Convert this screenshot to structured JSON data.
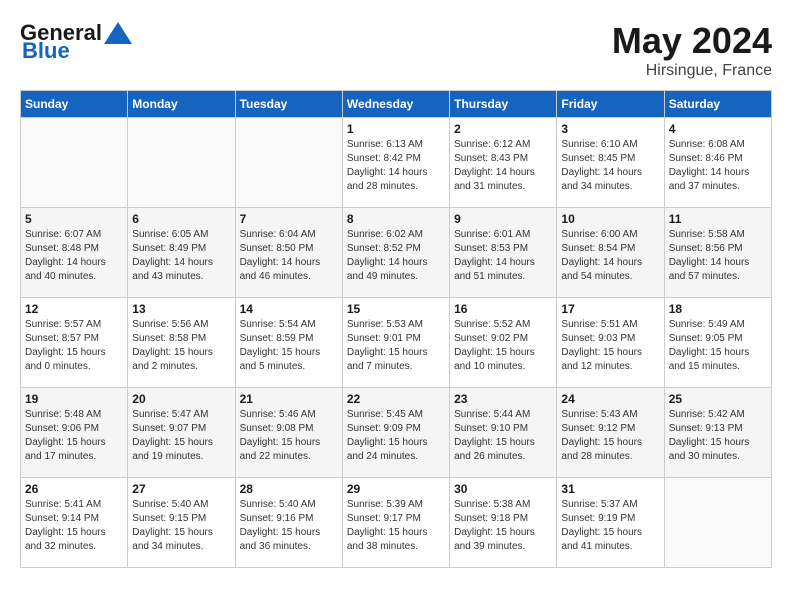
{
  "header": {
    "logo_general": "General",
    "logo_blue": "Blue",
    "month_year": "May 2024",
    "location": "Hirsingue, France"
  },
  "weekdays": [
    "Sunday",
    "Monday",
    "Tuesday",
    "Wednesday",
    "Thursday",
    "Friday",
    "Saturday"
  ],
  "weeks": [
    [
      {
        "day": "",
        "sunrise": "",
        "sunset": "",
        "daylight": ""
      },
      {
        "day": "",
        "sunrise": "",
        "sunset": "",
        "daylight": ""
      },
      {
        "day": "",
        "sunrise": "",
        "sunset": "",
        "daylight": ""
      },
      {
        "day": "1",
        "sunrise": "Sunrise: 6:13 AM",
        "sunset": "Sunset: 8:42 PM",
        "daylight": "Daylight: 14 hours and 28 minutes."
      },
      {
        "day": "2",
        "sunrise": "Sunrise: 6:12 AM",
        "sunset": "Sunset: 8:43 PM",
        "daylight": "Daylight: 14 hours and 31 minutes."
      },
      {
        "day": "3",
        "sunrise": "Sunrise: 6:10 AM",
        "sunset": "Sunset: 8:45 PM",
        "daylight": "Daylight: 14 hours and 34 minutes."
      },
      {
        "day": "4",
        "sunrise": "Sunrise: 6:08 AM",
        "sunset": "Sunset: 8:46 PM",
        "daylight": "Daylight: 14 hours and 37 minutes."
      }
    ],
    [
      {
        "day": "5",
        "sunrise": "Sunrise: 6:07 AM",
        "sunset": "Sunset: 8:48 PM",
        "daylight": "Daylight: 14 hours and 40 minutes."
      },
      {
        "day": "6",
        "sunrise": "Sunrise: 6:05 AM",
        "sunset": "Sunset: 8:49 PM",
        "daylight": "Daylight: 14 hours and 43 minutes."
      },
      {
        "day": "7",
        "sunrise": "Sunrise: 6:04 AM",
        "sunset": "Sunset: 8:50 PM",
        "daylight": "Daylight: 14 hours and 46 minutes."
      },
      {
        "day": "8",
        "sunrise": "Sunrise: 6:02 AM",
        "sunset": "Sunset: 8:52 PM",
        "daylight": "Daylight: 14 hours and 49 minutes."
      },
      {
        "day": "9",
        "sunrise": "Sunrise: 6:01 AM",
        "sunset": "Sunset: 8:53 PM",
        "daylight": "Daylight: 14 hours and 51 minutes."
      },
      {
        "day": "10",
        "sunrise": "Sunrise: 6:00 AM",
        "sunset": "Sunset: 8:54 PM",
        "daylight": "Daylight: 14 hours and 54 minutes."
      },
      {
        "day": "11",
        "sunrise": "Sunrise: 5:58 AM",
        "sunset": "Sunset: 8:56 PM",
        "daylight": "Daylight: 14 hours and 57 minutes."
      }
    ],
    [
      {
        "day": "12",
        "sunrise": "Sunrise: 5:57 AM",
        "sunset": "Sunset: 8:57 PM",
        "daylight": "Daylight: 15 hours and 0 minutes."
      },
      {
        "day": "13",
        "sunrise": "Sunrise: 5:56 AM",
        "sunset": "Sunset: 8:58 PM",
        "daylight": "Daylight: 15 hours and 2 minutes."
      },
      {
        "day": "14",
        "sunrise": "Sunrise: 5:54 AM",
        "sunset": "Sunset: 8:59 PM",
        "daylight": "Daylight: 15 hours and 5 minutes."
      },
      {
        "day": "15",
        "sunrise": "Sunrise: 5:53 AM",
        "sunset": "Sunset: 9:01 PM",
        "daylight": "Daylight: 15 hours and 7 minutes."
      },
      {
        "day": "16",
        "sunrise": "Sunrise: 5:52 AM",
        "sunset": "Sunset: 9:02 PM",
        "daylight": "Daylight: 15 hours and 10 minutes."
      },
      {
        "day": "17",
        "sunrise": "Sunrise: 5:51 AM",
        "sunset": "Sunset: 9:03 PM",
        "daylight": "Daylight: 15 hours and 12 minutes."
      },
      {
        "day": "18",
        "sunrise": "Sunrise: 5:49 AM",
        "sunset": "Sunset: 9:05 PM",
        "daylight": "Daylight: 15 hours and 15 minutes."
      }
    ],
    [
      {
        "day": "19",
        "sunrise": "Sunrise: 5:48 AM",
        "sunset": "Sunset: 9:06 PM",
        "daylight": "Daylight: 15 hours and 17 minutes."
      },
      {
        "day": "20",
        "sunrise": "Sunrise: 5:47 AM",
        "sunset": "Sunset: 9:07 PM",
        "daylight": "Daylight: 15 hours and 19 minutes."
      },
      {
        "day": "21",
        "sunrise": "Sunrise: 5:46 AM",
        "sunset": "Sunset: 9:08 PM",
        "daylight": "Daylight: 15 hours and 22 minutes."
      },
      {
        "day": "22",
        "sunrise": "Sunrise: 5:45 AM",
        "sunset": "Sunset: 9:09 PM",
        "daylight": "Daylight: 15 hours and 24 minutes."
      },
      {
        "day": "23",
        "sunrise": "Sunrise: 5:44 AM",
        "sunset": "Sunset: 9:10 PM",
        "daylight": "Daylight: 15 hours and 26 minutes."
      },
      {
        "day": "24",
        "sunrise": "Sunrise: 5:43 AM",
        "sunset": "Sunset: 9:12 PM",
        "daylight": "Daylight: 15 hours and 28 minutes."
      },
      {
        "day": "25",
        "sunrise": "Sunrise: 5:42 AM",
        "sunset": "Sunset: 9:13 PM",
        "daylight": "Daylight: 15 hours and 30 minutes."
      }
    ],
    [
      {
        "day": "26",
        "sunrise": "Sunrise: 5:41 AM",
        "sunset": "Sunset: 9:14 PM",
        "daylight": "Daylight: 15 hours and 32 minutes."
      },
      {
        "day": "27",
        "sunrise": "Sunrise: 5:40 AM",
        "sunset": "Sunset: 9:15 PM",
        "daylight": "Daylight: 15 hours and 34 minutes."
      },
      {
        "day": "28",
        "sunrise": "Sunrise: 5:40 AM",
        "sunset": "Sunset: 9:16 PM",
        "daylight": "Daylight: 15 hours and 36 minutes."
      },
      {
        "day": "29",
        "sunrise": "Sunrise: 5:39 AM",
        "sunset": "Sunset: 9:17 PM",
        "daylight": "Daylight: 15 hours and 38 minutes."
      },
      {
        "day": "30",
        "sunrise": "Sunrise: 5:38 AM",
        "sunset": "Sunset: 9:18 PM",
        "daylight": "Daylight: 15 hours and 39 minutes."
      },
      {
        "day": "31",
        "sunrise": "Sunrise: 5:37 AM",
        "sunset": "Sunset: 9:19 PM",
        "daylight": "Daylight: 15 hours and 41 minutes."
      },
      {
        "day": "",
        "sunrise": "",
        "sunset": "",
        "daylight": ""
      }
    ]
  ]
}
